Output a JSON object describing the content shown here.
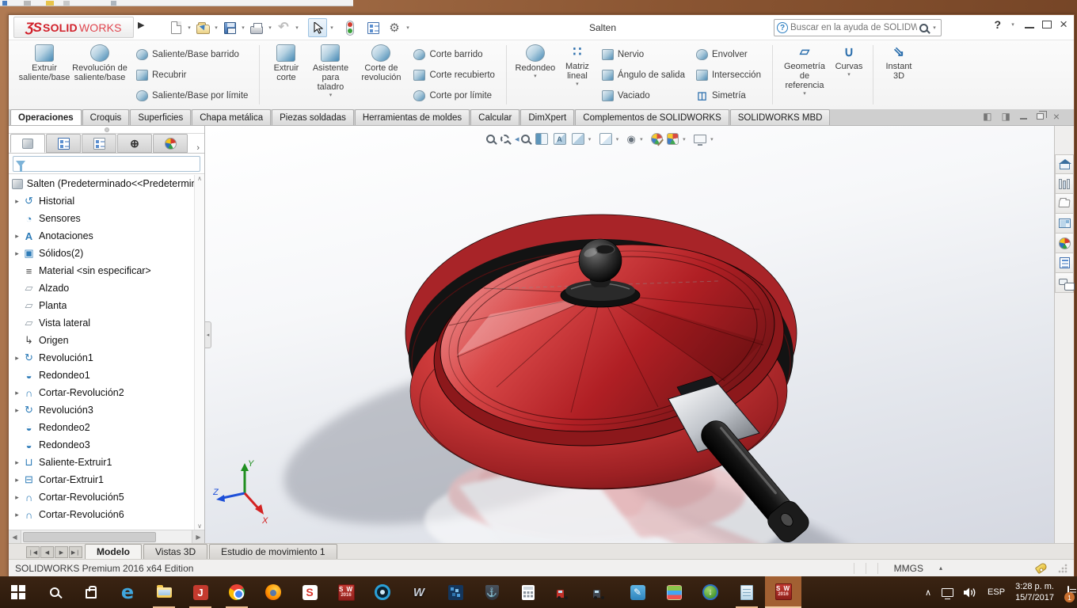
{
  "icons": {
    "dropdown": "▾",
    "expand": "▸",
    "caret_up": "▴",
    "scroll_up": "∧",
    "scroll_down": "∨",
    "scroll_left": "◀",
    "scroll_right": "▶",
    "nav_first": "❘◀",
    "nav_prev": "◀",
    "nav_next": "▶",
    "nav_last": "▶❘",
    "pane_left": "◧",
    "pane_right": "◨",
    "close": "×",
    "help": "?",
    "undo": "↶",
    "gear": "⚙",
    "crosshair": "⊕",
    "eye": "◉",
    "panel_more": "›",
    "collapse_left": "◂",
    "chevron_up": "∧",
    "matriz": "∷",
    "curvas": "∪",
    "instant3d": "⇘",
    "plane": "▱",
    "simetria": "◫",
    "letter_a": "A"
  },
  "titlebar": {
    "logo_glyph": "ƷS",
    "brand_bold": "SOLID",
    "brand_light": "WORKS",
    "flyout": "▶",
    "title": "Salten",
    "search_placeholder": "Buscar en la ayuda de SOLIDWORKS"
  },
  "ribbon": {
    "extrude_boss": "Extruir saliente/base",
    "revolve_boss": "Revolución de saliente/base",
    "swept_boss": "Saliente/Base barrido",
    "loft": "Recubrir",
    "boundary_boss": "Saliente/Base por límite",
    "extrude_cut": "Extruir corte",
    "hole_wizard": "Asistente para taladro",
    "revolve_cut": "Corte de revolución",
    "swept_cut": "Corte barrido",
    "lofted_cut": "Corte recubierto",
    "boundary_cut": "Corte por límite",
    "fillet": "Redondeo",
    "linear_pattern": "Matriz lineal",
    "rib": "Nervio",
    "draft": "Ángulo de salida",
    "shell": "Vaciado",
    "wrap": "Envolver",
    "intersect": "Intersección",
    "mirror": "Simetría",
    "ref_geom": "Geometría de referencia",
    "curves": "Curvas",
    "instant3d": "Instant 3D"
  },
  "ribbon_tabs": [
    "Operaciones",
    "Croquis",
    "Superficies",
    "Chapa metálica",
    "Piezas soldadas",
    "Herramientas de moldes",
    "Calcular",
    "DimXpert",
    "Complementos de SOLIDWORKS",
    "SOLIDWORKS MBD"
  ],
  "tree": {
    "root": "Salten  (Predeterminado<<Predetermin",
    "items": [
      {
        "glyph": "↺",
        "label": "Historial"
      },
      {
        "glyph": "◔",
        "label": "Sensores"
      },
      {
        "glyph": "A",
        "label": "Anotaciones"
      },
      {
        "glyph": "▣",
        "label": "Sólidos(2)"
      },
      {
        "glyph": "≡",
        "label": "Material <sin especificar>"
      },
      {
        "glyph": "▱",
        "label": "Alzado"
      },
      {
        "glyph": "▱",
        "label": "Planta"
      },
      {
        "glyph": "▱",
        "label": "Vista lateral"
      },
      {
        "glyph": "↳",
        "label": "Origen"
      },
      {
        "glyph": "↻",
        "label": "Revolución1"
      },
      {
        "glyph": "◒",
        "label": "Redondeo1"
      },
      {
        "glyph": "∩",
        "label": "Cortar-Revolución2"
      },
      {
        "glyph": "↻",
        "label": "Revolución3"
      },
      {
        "glyph": "◒",
        "label": "Redondeo2"
      },
      {
        "glyph": "◒",
        "label": "Redondeo3"
      },
      {
        "glyph": "⊔",
        "label": "Saliente-Extruir1"
      },
      {
        "glyph": "⊟",
        "label": "Cortar-Extruir1"
      },
      {
        "glyph": "∩",
        "label": "Cortar-Revolución5"
      },
      {
        "glyph": "∩",
        "label": "Cortar-Revolución6"
      }
    ]
  },
  "hud_icons": [
    "zoom-to-fit",
    "zoom-to-area",
    "previous-view",
    "section-view",
    "annotation-visibility",
    "view-orientation",
    "display-style",
    "hide-show-items",
    "edit-appearance",
    "apply-scene",
    "view-settings"
  ],
  "taskpane_icons": [
    "solidworks-resources",
    "design-library",
    "file-explorer",
    "view-palette",
    "appearances-scenes",
    "custom-properties",
    "solidworks-forum"
  ],
  "panel_tab_icons": [
    "featuremanager-design-tree",
    "propertymanager",
    "configurationmanager",
    "dimxpertmanager",
    "displaymanager"
  ],
  "triad": {
    "x": "X",
    "y": "Y",
    "z": "Z"
  },
  "bottom_tabs": [
    "Modelo",
    "Vistas 3D",
    "Estudio de movimiento 1"
  ],
  "status": {
    "edition": "SOLIDWORKS Premium 2016 x64 Edition",
    "units": "MMGS"
  },
  "taskbar": {
    "lang": "ESP",
    "time": "3:28 p. m.",
    "date": "15/7/2017",
    "notification_count": "1",
    "glyphs": {
      "edge": "e",
      "red_app": "J",
      "sketchup": "S",
      "sw_line1": "S W",
      "sw_line2": "2016",
      "anchor": "⚓",
      "war_thunder": "W",
      "idm_arrow": "↓",
      "blue_pen": "✎"
    },
    "icons": [
      "start",
      "search",
      "store",
      "edge",
      "file-explorer",
      "red-app",
      "chrome",
      "firefox",
      "sketchup",
      "solidworks-2016",
      "keyshot",
      "war-thunder",
      "mosaic-app",
      "world-of-warships",
      "calculator",
      "american-truck-simulator",
      "euro-truck-simulator-2",
      "blue-pen-app",
      "bluestacks",
      "idm",
      "notepad",
      "solidworks-2016-active"
    ]
  },
  "colors": {
    "accent_red": "#c1272d",
    "taskbar_brown": "#31200f",
    "highlight_peach": "#edbf92",
    "viewport_bottom": "#d5d8e1"
  }
}
